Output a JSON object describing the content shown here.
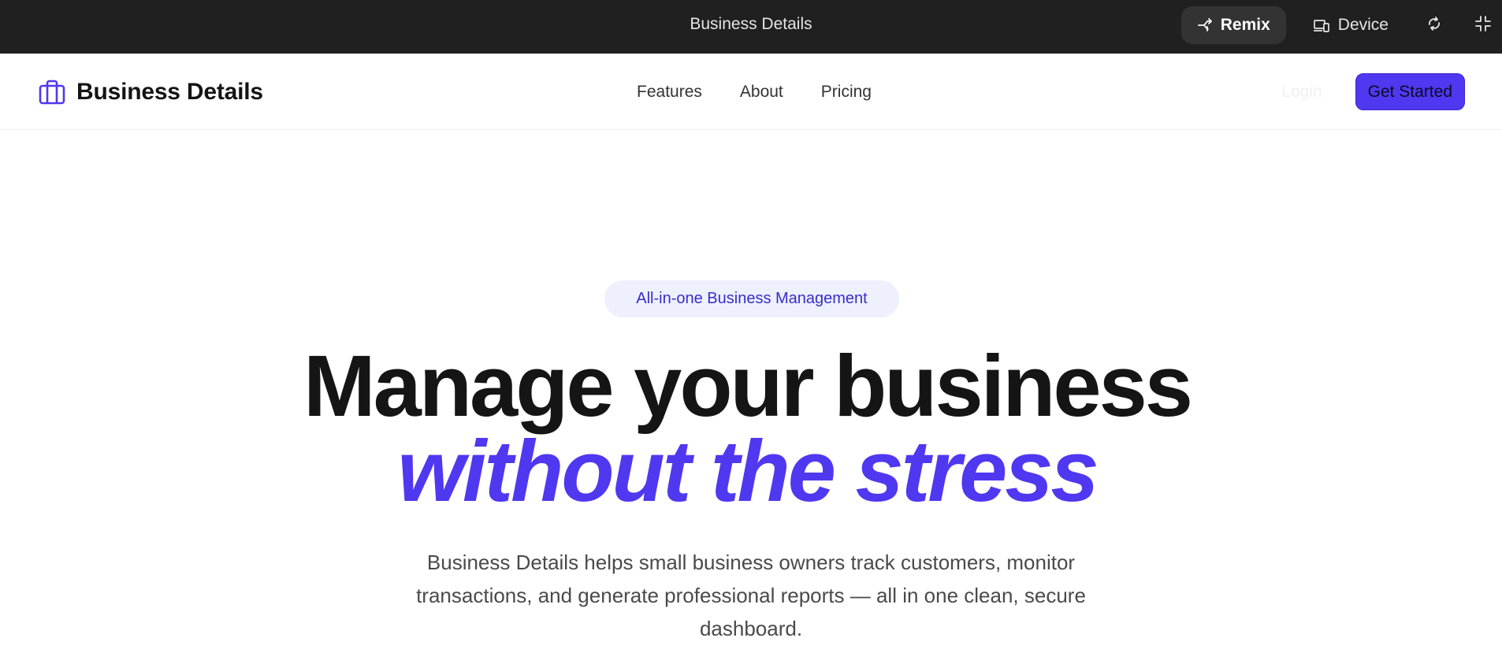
{
  "topbar": {
    "title": "Business Details",
    "remix_label": "Remix",
    "device_label": "Device",
    "icons": {
      "remix": "remix-icon",
      "device": "device-icon",
      "refresh": "refresh-icon",
      "collapse": "collapse-icon"
    }
  },
  "header": {
    "brand_name": "Business Details",
    "brand_icon": "briefcase-icon",
    "nav": [
      "Features",
      "About",
      "Pricing"
    ],
    "login_label": "Login",
    "cta_label": "Get Started"
  },
  "hero": {
    "badge": "All-in-one Business Management",
    "headline_line1": "Manage your business",
    "headline_line2": "without the stress",
    "subtext": "Business Details helps small business owners track customers, monitor transactions, and generate professional reports — all in one clean, secure dashboard."
  },
  "colors": {
    "accent": "#4f38f0",
    "topbar_bg": "#202020",
    "badge_bg": "#eef0fd",
    "heading": "#151515",
    "body_text": "#4a4a4a"
  }
}
